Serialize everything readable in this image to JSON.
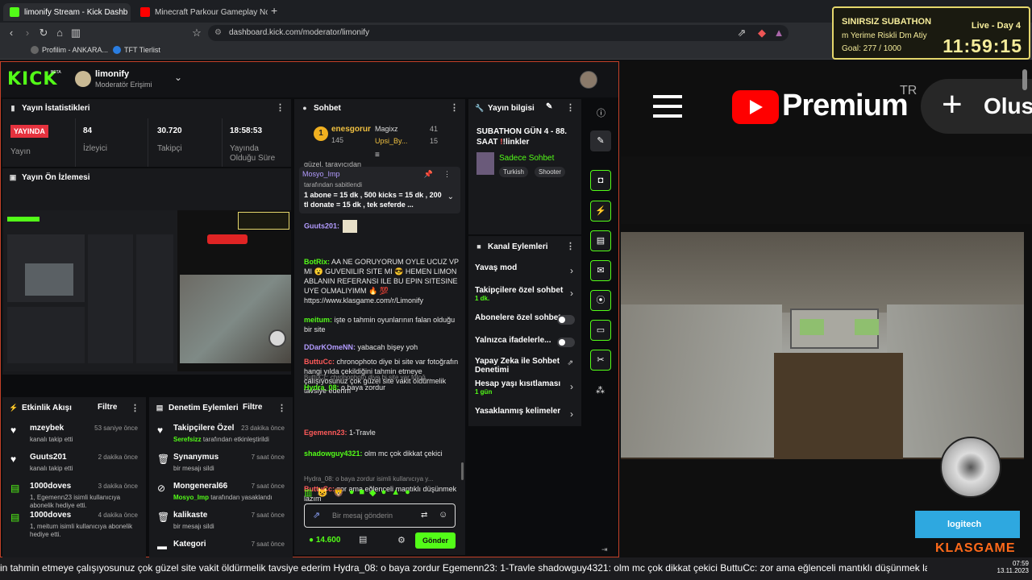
{
  "browser": {
    "tabs": [
      {
        "label": "limonify Stream - Kick Dashb"
      },
      {
        "label": "Minecraft Parkour Gameplay No Cop"
      }
    ],
    "url": "dashboard.kick.com/moderator/limonify",
    "bookmarks": [
      {
        "label": "Profilim - ANKARA..."
      },
      {
        "label": "TFT Tierlist"
      }
    ]
  },
  "subathon": {
    "title": "SINIRSIZ SUBATHON",
    "scroll": "m Yerime Riskli Dm Atiy",
    "goal": "Goal: 277 / 1000",
    "day": "Live - Day 4",
    "timer": "11:59:15"
  },
  "header": {
    "logo": "KICK",
    "beta": "BETA",
    "channel": "limonify",
    "role": "Moderatör Erişimi"
  },
  "stats": {
    "title": "Yayın İstatistikleri",
    "live_badge": "YAYINDA",
    "live_label": "Yayın",
    "viewers": "84",
    "viewers_label": "İzleyici",
    "followers": "30.720",
    "followers_label": "Takipçi",
    "duration": "18:58:53",
    "duration_label": "Yayında Olduğu Süre"
  },
  "preview": {
    "title": "Yayın Ön İzlemesi"
  },
  "activity": {
    "title": "Etkinlik Akışı",
    "filter": "Filtre",
    "items": [
      {
        "icon": "heart-icon",
        "name": "mzeybek",
        "sub": "kanalı takip etti",
        "time": "53 saniye önce"
      },
      {
        "icon": "heart-icon",
        "name": "Guuts201",
        "sub": "kanalı takip etti",
        "time": "2 dakika önce"
      },
      {
        "icon": "gift-icon",
        "name": "1000doves",
        "sub": "1, Egemenn23 isimli kullanıcıya abonelik hediye etti.",
        "time": "3 dakika önce"
      },
      {
        "icon": "gift-icon",
        "name": "1000doves",
        "sub": "1, meitum isimli kullanıcıya abonelik hediye etti.",
        "time": "4 dakika önce"
      }
    ]
  },
  "modlog": {
    "title": "Denetim Eylemleri",
    "filter": "Filtre",
    "items": [
      {
        "name": "Takipçilere Özel",
        "sub_user": "Serefsizz",
        "sub": "tarafından etkinleştirildi",
        "time": "23 dakika önce"
      },
      {
        "name": "Synanymus",
        "sub_user": "",
        "sub": "bir mesajı sildi",
        "time": "7 saat önce"
      },
      {
        "name": "Mongeneral66",
        "sub_user": "Mosyo_Imp",
        "sub": "tarafından yasaklandı",
        "time": "7 saat önce"
      },
      {
        "name": "kalikaste",
        "sub_user": "",
        "sub": "bir mesajı sildi",
        "time": "7 saat önce"
      },
      {
        "name": "Kategori",
        "sub_user": "",
        "sub": "",
        "time": "7 saat önce"
      }
    ]
  },
  "chat": {
    "title": "Sohbet",
    "top": [
      {
        "name": "enesgorur",
        "count": "145"
      },
      {
        "name": "Magixz",
        "count": "41"
      },
      {
        "name": "Upsi_By...",
        "count": "15"
      }
    ],
    "clipped": "güzel, tarayıcıdan",
    "pinned_user": "Mosyo_Imp",
    "pinned_by": "tarafından sabitlendi",
    "pinned_text": "1 abone = 15 dk , 500 kicks = 15 dk , 200 tl donate = 15 dk , tek seferde ...",
    "messages": [
      {
        "user": "Guuts201:",
        "text": "",
        "color": "#b39cff"
      },
      {
        "user": "BotRix:",
        "text": "AA NE GORUYORUM OYLE UCUZ VP MI 😮 GUVENILIR SITE MI 😎 HEMEN LIMON ABLANIN REFERANSI ILE BU EPIN SITESINE UYE OLMALIYIMM 🔥 💯 https://www.klasgame.com/r/Limonify",
        "color": "#53fc18"
      },
      {
        "user": "meitum:",
        "text": "işte o tahmin oyunlarının falan olduğu bir site",
        "color": "#53fc18"
      },
      {
        "user": "DDarKOmeNN:",
        "text": "yabacah bişey yoh",
        "color": "#b39cff"
      },
      {
        "user": "ButtuCc:",
        "text": "chronophoto diye bi site var fotoğrafın hangi yılda çekildiğini tahmin etmeye çalışıyosunuz çok güzel site vakit öldürmelik tavsiye ederim",
        "color": "#ff5a5a"
      },
      {
        "reply": "ButtuCc: chronophoto diye bi site var fotoğ...",
        "user": "Hydra_08:",
        "text": "o baya zordur",
        "color": "#53fc18"
      },
      {
        "user": "Egemenn23:",
        "text": "1-Travle",
        "color": "#ff5a5a"
      },
      {
        "user": "shadowguy4321:",
        "text": "olm mc çok dikkat çekici",
        "color": "#53fc18"
      },
      {
        "reply": "Hydra_08: o baya zordur isimli kullanıcıya y...",
        "user": "ButtuCc:",
        "text": "zor ama eğlenceli mantıklı düşünmek lazım",
        "color": "#ff5a5a"
      }
    ],
    "placeholder": "Bir mesaj gönderin",
    "balance": "14.600",
    "send": "Gönder"
  },
  "streaminfo": {
    "title": "Yayın bilgisi",
    "stream_title": "SUBATHON GÜN 4 - 88. SAAT",
    "links": "!linkler",
    "category": "Sadece Sohbet",
    "tags": [
      "Turkish",
      "Shooter"
    ]
  },
  "channel_actions": {
    "title": "Kanal Eylemleri",
    "items": [
      {
        "label": "Yavaş mod",
        "sub": "",
        "control": "chevron"
      },
      {
        "label": "Takipçilere özel sohbet",
        "sub": "1 dk.",
        "control": "chevron"
      },
      {
        "label": "Abonelere özel sohbet",
        "sub": "",
        "control": "toggle"
      },
      {
        "label": "Yalnızca ifadelerle...",
        "sub": "",
        "control": "toggle"
      },
      {
        "label": "Yapay Zeka ile Sohbet Denetimi",
        "sub": "",
        "control": "external"
      },
      {
        "label": "Hesap yaşı kısıtlaması",
        "sub": "1 gün",
        "control": "chevron"
      },
      {
        "label": "Yasaklanmış kelimeler",
        "sub": "",
        "control": "chevron"
      }
    ]
  },
  "youtube": {
    "brand": "Premium",
    "tr": "TR",
    "create": "Olus"
  },
  "overlay": {
    "logitech": "logitech",
    "klasgame": "KLASGAME"
  },
  "ticker": "in tahmin etmeye çalışıyosunuz çok güzel site vakit öldürmelik tavsiye ederim  Hydra_08: o baya zordur  Egemenn23: 1-Travle  shadowguy4321: olm mc çok dikkat çekici  ButtuCc: zor ama eğlenceli mantıklı düşünmek lazım",
  "clock": {
    "time": "07:59",
    "date": "13.11.2023"
  }
}
